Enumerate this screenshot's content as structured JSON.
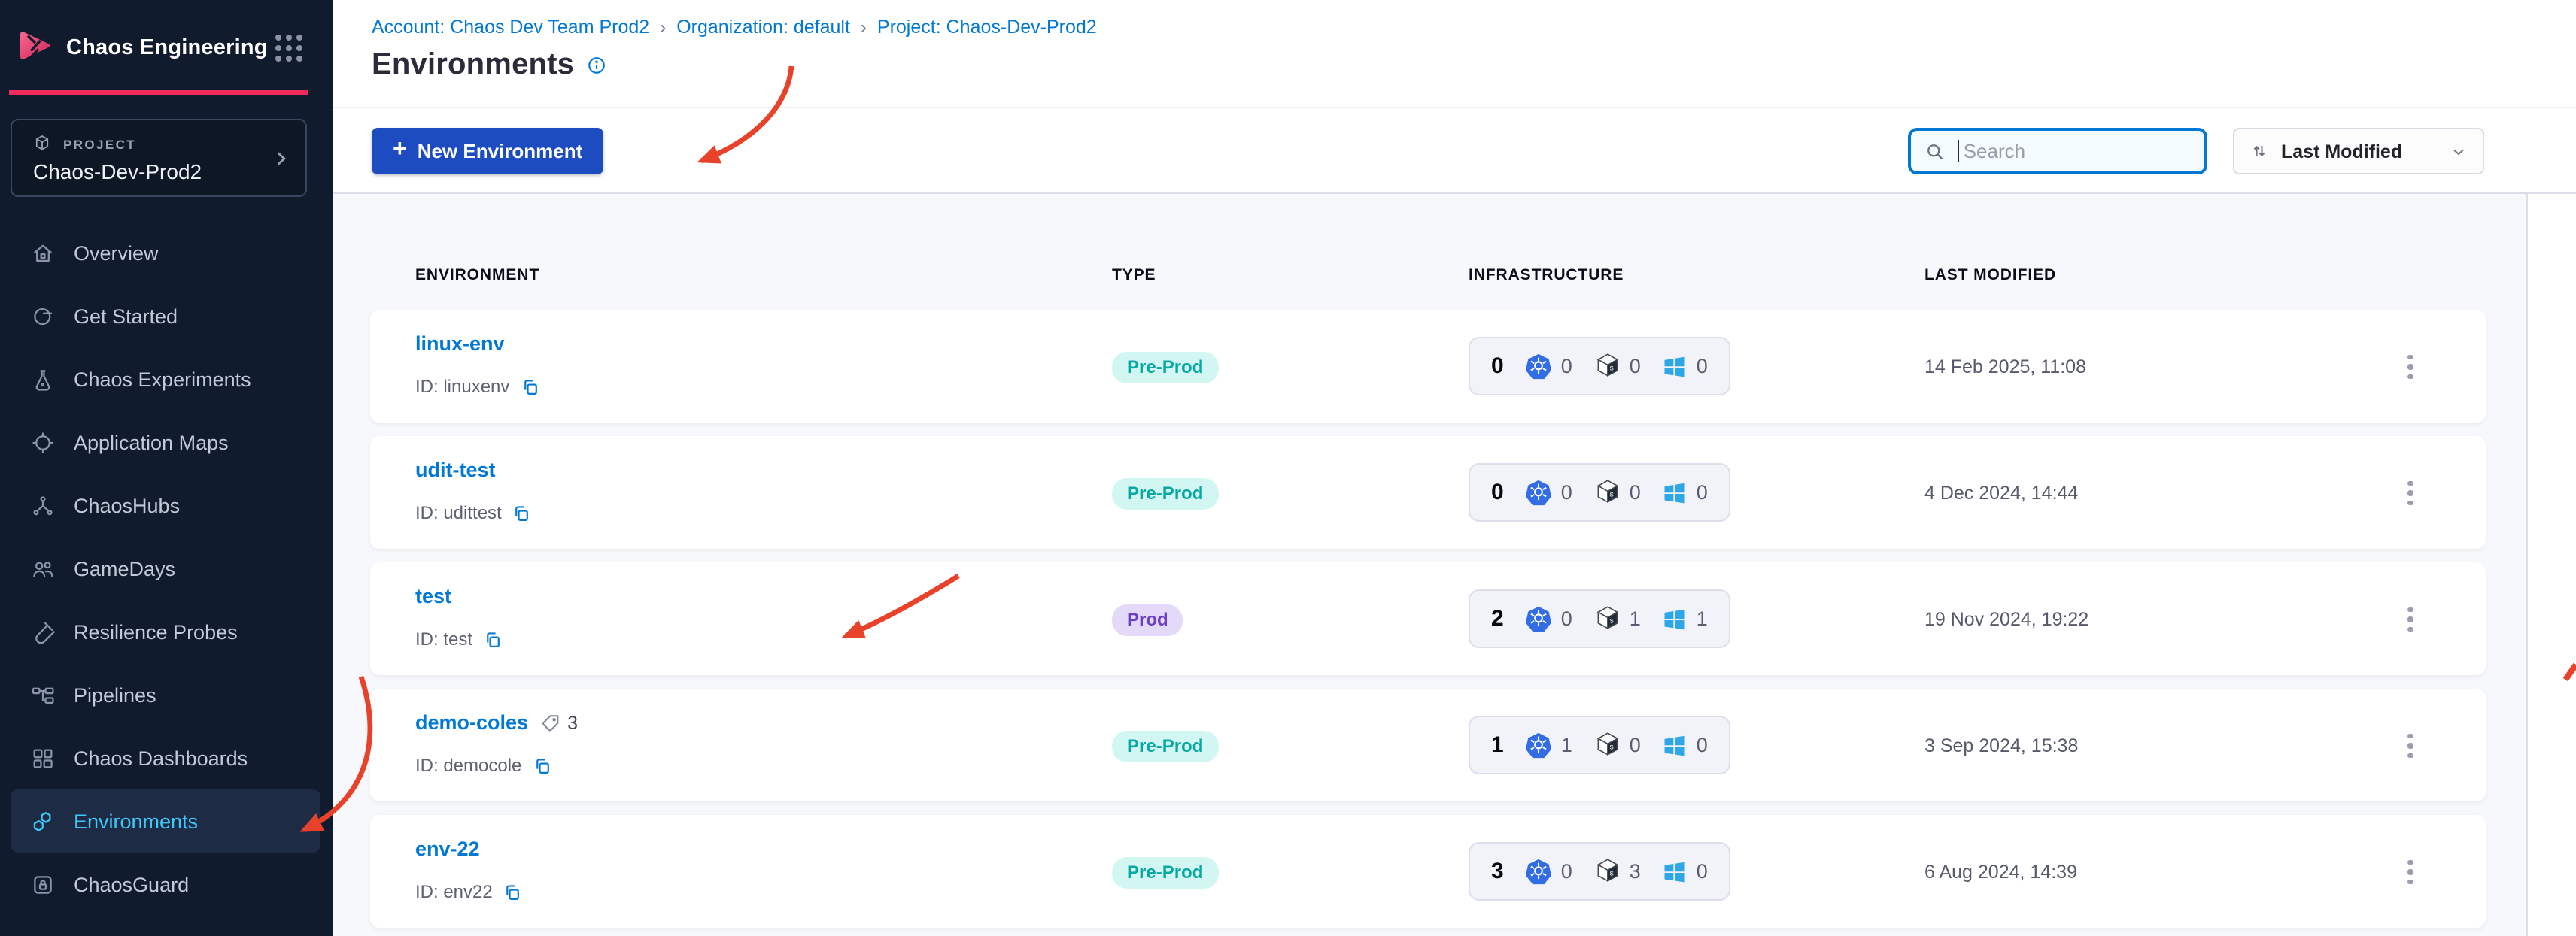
{
  "colors": {
    "brand_pink": "#f22a5e",
    "primary_blue": "#0278d5",
    "button_blue": "#1d4cc1",
    "sidebar_bg": "#101c2e",
    "selected_item_text": "#3fc8f7",
    "preprod_bg": "#d2f7f3",
    "preprod_text": "#08a7a2",
    "prod_bg": "#e3dafa",
    "prod_text": "#6c40c5",
    "annotation_red": "#e8432a",
    "kubernetes_blue": "#326de6",
    "windows_blue": "#2ea7e8"
  },
  "sidebar": {
    "app_title": "Chaos Engineering",
    "project_label": "PROJECT",
    "project_name": "Chaos-Dev-Prod2",
    "items": [
      {
        "icon": "home-icon",
        "label": "Overview",
        "selected": false
      },
      {
        "icon": "get-started-icon",
        "label": "Get Started",
        "selected": false
      },
      {
        "icon": "flask-icon",
        "label": "Chaos Experiments",
        "selected": false
      },
      {
        "icon": "target-icon",
        "label": "Application Maps",
        "selected": false
      },
      {
        "icon": "network-icon",
        "label": "ChaosHubs",
        "selected": false
      },
      {
        "icon": "people-icon",
        "label": "GameDays",
        "selected": false
      },
      {
        "icon": "test-tube-icon",
        "label": "Resilience Probes",
        "selected": false
      },
      {
        "icon": "pipelines-icon",
        "label": "Pipelines",
        "selected": false
      },
      {
        "icon": "dashboards-icon",
        "label": "Chaos Dashboards",
        "selected": false
      },
      {
        "icon": "hexagons-icon",
        "label": "Environments",
        "selected": true
      },
      {
        "icon": "lock-icon",
        "label": "ChaosGuard",
        "selected": false
      }
    ]
  },
  "breadcrumb": {
    "separator": "›",
    "items": [
      "Account: Chaos Dev Team Prod2",
      "Organization: default",
      "Project: Chaos-Dev-Prod2"
    ]
  },
  "header": {
    "title": "Environments"
  },
  "toolbar": {
    "new_button_label": "New Environment",
    "plus": "+",
    "search_placeholder": "Search",
    "sort_label": "Last Modified"
  },
  "table": {
    "columns": [
      "ENVIRONMENT",
      "TYPE",
      "INFRASTRUCTURE",
      "LAST MODIFIED"
    ],
    "rows": [
      {
        "name": "linux-env",
        "id_label": "ID: linuxenv",
        "type": "Pre-Prod",
        "tag_count": "",
        "total": "0",
        "kubernetes": "0",
        "linux": "0",
        "windows": "0",
        "modified": "14 Feb 2025, 11:08"
      },
      {
        "name": "udit-test",
        "id_label": "ID: udittest",
        "type": "Pre-Prod",
        "tag_count": "",
        "total": "0",
        "kubernetes": "0",
        "linux": "0",
        "windows": "0",
        "modified": "4 Dec 2024, 14:44"
      },
      {
        "name": "test",
        "id_label": "ID: test",
        "type": "Prod",
        "tag_count": "",
        "total": "2",
        "kubernetes": "0",
        "linux": "1",
        "windows": "1",
        "modified": "19 Nov 2024, 19:22"
      },
      {
        "name": "demo-coles",
        "id_label": "ID: democole",
        "type": "Pre-Prod",
        "tag_count": "3",
        "total": "1",
        "kubernetes": "1",
        "linux": "0",
        "windows": "0",
        "modified": "3 Sep 2024, 15:38"
      },
      {
        "name": "env-22",
        "id_label": "ID: env22",
        "type": "Pre-Prod",
        "tag_count": "",
        "total": "3",
        "kubernetes": "0",
        "linux": "3",
        "windows": "0",
        "modified": "6 Aug 2024, 14:39"
      }
    ]
  }
}
